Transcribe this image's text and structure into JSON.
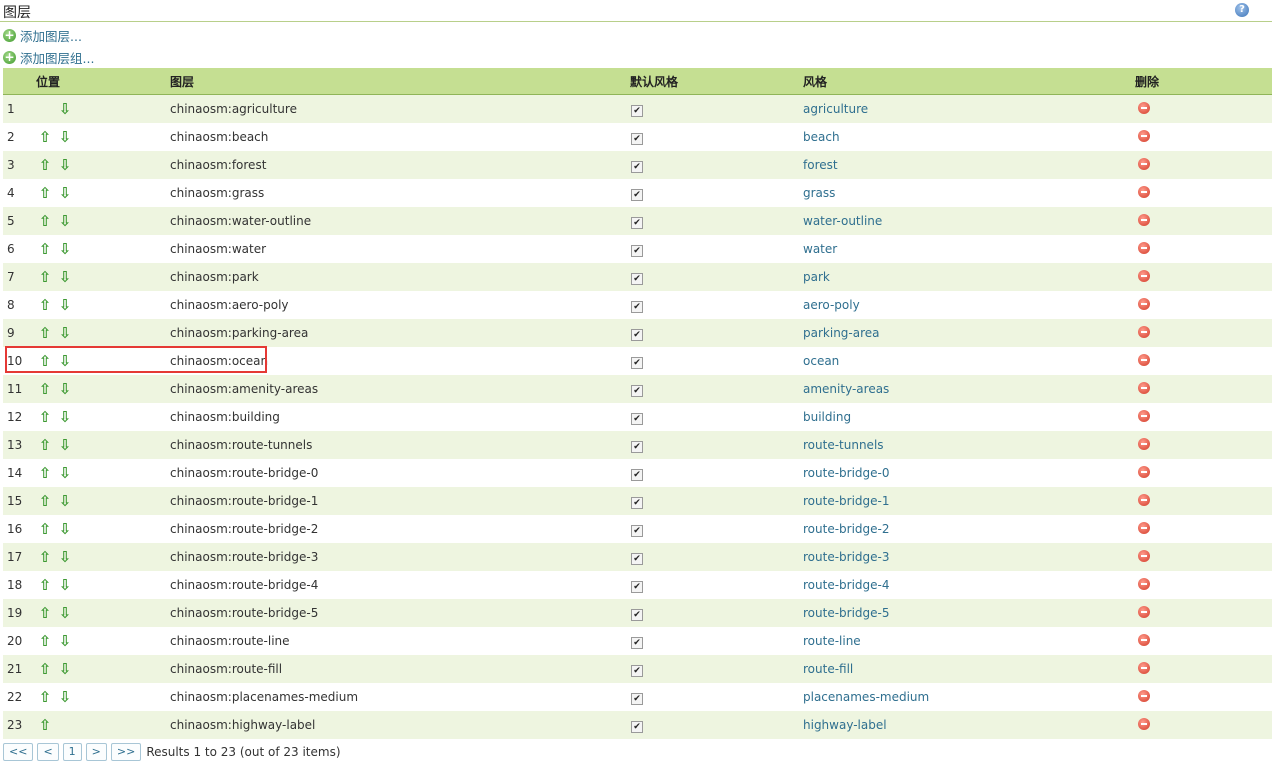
{
  "header": {
    "title": "图层",
    "help_icon": "help-icon"
  },
  "actions": {
    "add_layer": "添加图层...",
    "add_layer_group": "添加图层组..."
  },
  "table": {
    "columns": {
      "position": "位置",
      "layer": "图层",
      "default_style": "默认风格",
      "style": "风格",
      "delete": "删除"
    },
    "rows": [
      {
        "num": "1",
        "layer": "chinaosm:agriculture",
        "style": "agriculture",
        "default": true,
        "up": false,
        "down": true
      },
      {
        "num": "2",
        "layer": "chinaosm:beach",
        "style": "beach",
        "default": true,
        "up": true,
        "down": true
      },
      {
        "num": "3",
        "layer": "chinaosm:forest",
        "style": "forest",
        "default": true,
        "up": true,
        "down": true
      },
      {
        "num": "4",
        "layer": "chinaosm:grass",
        "style": "grass",
        "default": true,
        "up": true,
        "down": true
      },
      {
        "num": "5",
        "layer": "chinaosm:water-outline",
        "style": "water-outline",
        "default": true,
        "up": true,
        "down": true
      },
      {
        "num": "6",
        "layer": "chinaosm:water",
        "style": "water",
        "default": true,
        "up": true,
        "down": true
      },
      {
        "num": "7",
        "layer": "chinaosm:park",
        "style": "park",
        "default": true,
        "up": true,
        "down": true
      },
      {
        "num": "8",
        "layer": "chinaosm:aero-poly",
        "style": "aero-poly",
        "default": true,
        "up": true,
        "down": true
      },
      {
        "num": "9",
        "layer": "chinaosm:parking-area",
        "style": "parking-area",
        "default": true,
        "up": true,
        "down": true
      },
      {
        "num": "10",
        "layer": "chinaosm:ocean",
        "style": "ocean",
        "default": true,
        "up": true,
        "down": true
      },
      {
        "num": "11",
        "layer": "chinaosm:amenity-areas",
        "style": "amenity-areas",
        "default": true,
        "up": true,
        "down": true
      },
      {
        "num": "12",
        "layer": "chinaosm:building",
        "style": "building",
        "default": true,
        "up": true,
        "down": true
      },
      {
        "num": "13",
        "layer": "chinaosm:route-tunnels",
        "style": "route-tunnels",
        "default": true,
        "up": true,
        "down": true
      },
      {
        "num": "14",
        "layer": "chinaosm:route-bridge-0",
        "style": "route-bridge-0",
        "default": true,
        "up": true,
        "down": true
      },
      {
        "num": "15",
        "layer": "chinaosm:route-bridge-1",
        "style": "route-bridge-1",
        "default": true,
        "up": true,
        "down": true
      },
      {
        "num": "16",
        "layer": "chinaosm:route-bridge-2",
        "style": "route-bridge-2",
        "default": true,
        "up": true,
        "down": true
      },
      {
        "num": "17",
        "layer": "chinaosm:route-bridge-3",
        "style": "route-bridge-3",
        "default": true,
        "up": true,
        "down": true
      },
      {
        "num": "18",
        "layer": "chinaosm:route-bridge-4",
        "style": "route-bridge-4",
        "default": true,
        "up": true,
        "down": true
      },
      {
        "num": "19",
        "layer": "chinaosm:route-bridge-5",
        "style": "route-bridge-5",
        "default": true,
        "up": true,
        "down": true
      },
      {
        "num": "20",
        "layer": "chinaosm:route-line",
        "style": "route-line",
        "default": true,
        "up": true,
        "down": true
      },
      {
        "num": "21",
        "layer": "chinaosm:route-fill",
        "style": "route-fill",
        "default": true,
        "up": true,
        "down": true
      },
      {
        "num": "22",
        "layer": "chinaosm:placenames-medium",
        "style": "placenames-medium",
        "default": true,
        "up": true,
        "down": true
      },
      {
        "num": "23",
        "layer": "chinaosm:highway-label",
        "style": "highway-label",
        "default": true,
        "up": true,
        "down": false
      }
    ],
    "highlighted_row": "10"
  },
  "pager": {
    "first": "<<",
    "prev": "<",
    "page": "1",
    "next": ">",
    "last": ">>",
    "info": "Results 1 to 23 (out of 23 items)"
  },
  "colors": {
    "header_bg": "#c5df92",
    "row_alt": "#eef5e0",
    "link": "#2f6f8f",
    "highlight": "#e53935"
  }
}
